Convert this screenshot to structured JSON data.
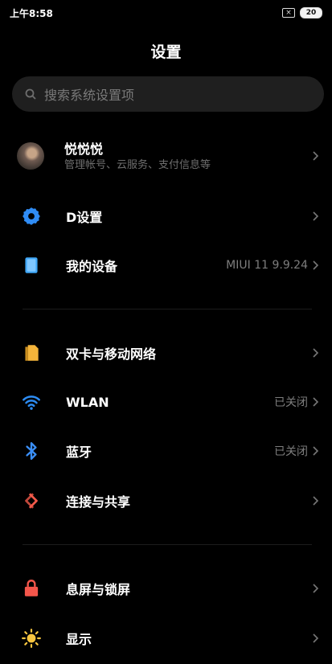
{
  "status": {
    "time": "上午8:58",
    "sim": "×",
    "battery": "20"
  },
  "header": {
    "title": "设置"
  },
  "search": {
    "placeholder": "搜索系统设置项"
  },
  "profile": {
    "name": "悦悦悦",
    "subtitle": "管理帐号、云服务、支付信息等"
  },
  "items": {
    "dsettings": {
      "label": "D设置"
    },
    "mydevice": {
      "label": "我的设备",
      "value": "MIUI 11 9.9.24"
    },
    "dualsim": {
      "label": "双卡与移动网络"
    },
    "wlan": {
      "label": "WLAN",
      "value": "已关闭"
    },
    "bluetooth": {
      "label": "蓝牙",
      "value": "已关闭"
    },
    "share": {
      "label": "连接与共享"
    },
    "lockscreen": {
      "label": "息屏与锁屏"
    },
    "display": {
      "label": "显示"
    }
  },
  "colors": {
    "gear": "#2f8cf5",
    "device": "#3fa7f8",
    "sim": "#f4b43a",
    "wifi": "#2d8cf3",
    "bluetooth": "#3a8ef6",
    "share": "#f35a4a",
    "lock": "#f4564b",
    "sun": "#f8c640"
  },
  "icons": [
    "search-icon",
    "avatar",
    "gear-icon",
    "device-icon",
    "sim-card-icon",
    "wifi-icon",
    "bluetooth-icon",
    "share-icon",
    "lock-icon",
    "sun-icon",
    "chevron-right-icon"
  ]
}
